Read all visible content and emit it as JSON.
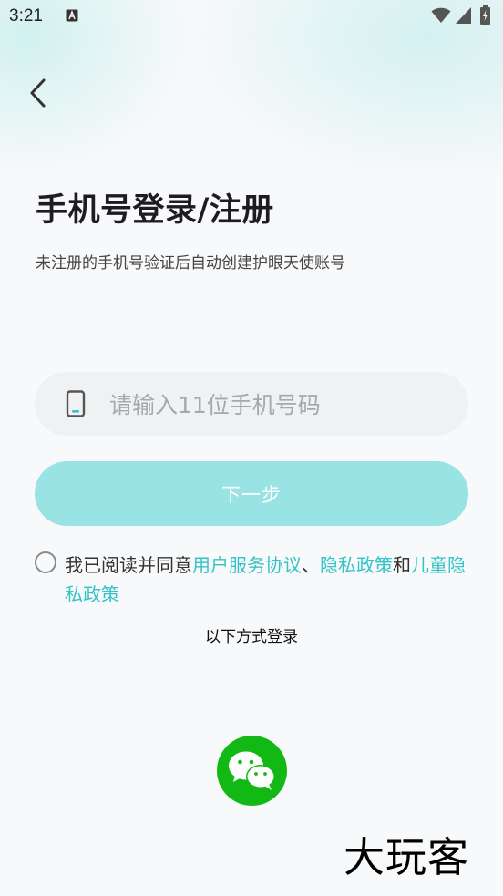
{
  "status_bar": {
    "time": "3:21",
    "icons": [
      "keyboard-a-icon",
      "wifi-icon",
      "signal-icon",
      "battery-charging-icon"
    ]
  },
  "nav": {
    "back_icon": "chevron-left-icon"
  },
  "header": {
    "title": "手机号登录/注册",
    "subtitle": "未注册的手机号验证后自动创建护眼天使账号"
  },
  "phone_field": {
    "icon": "phone-icon",
    "placeholder": "请输入11位手机号码",
    "value": ""
  },
  "next_button": {
    "label": "下一步"
  },
  "agreement": {
    "checked": false,
    "prefix": "我已阅读并同意",
    "link_user_agreement": "用户服务协议",
    "sep1": "、",
    "link_privacy": "隐私政策",
    "sep2": "和",
    "link_child_privacy": "儿童隐私政策"
  },
  "alt_login": {
    "label": "以下方式登录",
    "wechat_icon": "wechat-icon"
  },
  "watermark": {
    "text": "大玩客"
  },
  "colors": {
    "accent": "#34c4c8",
    "button_disabled": "#99e3e4",
    "wechat_green": "#12b813",
    "input_bg": "#f0f1f3"
  }
}
